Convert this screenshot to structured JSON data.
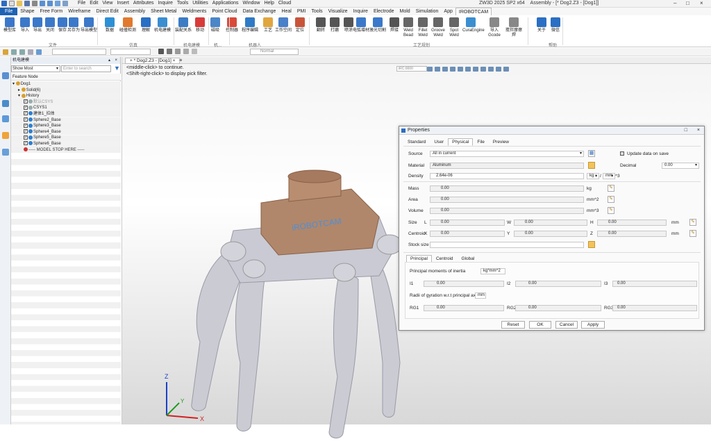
{
  "titlebar": {
    "menus": [
      "File",
      "Edit",
      "View",
      "Insert",
      "Attributes",
      "Inquire",
      "Tools",
      "Utilities",
      "Applications",
      "Window",
      "Help",
      "Cloud"
    ],
    "window_title": "ZW3D 2025 SP2 x64",
    "doc_title": "Assembly - [* Dog2.Z3 - [Dog1]]"
  },
  "ribbon_tabs": [
    "File",
    "Shape",
    "Free Form",
    "Wireframe",
    "Direct Edit",
    "Assembly",
    "Sheet Metal",
    "Weldments",
    "Point Cloud",
    "Data Exchange",
    "Heal",
    "PMI",
    "Tools",
    "Visualize",
    "Inquire",
    "Electrode",
    "Mold",
    "Simulation",
    "App",
    "IROBOTCAM"
  ],
  "ribbon_buttons": [
    "模型库",
    "导入",
    "导出",
    "关闭",
    "保存",
    "另存为",
    "导出模型",
    "数据",
    "碰撞检测",
    "理解",
    "机电建模",
    "装配关系",
    "移动",
    "磁吸",
    "控制器",
    "程序编辑",
    "工艺",
    "工作空间",
    "定位",
    "翻转",
    "打磨",
    "喷涂",
    "电弧增材",
    "激光切割",
    "焊接",
    "Weld Bead",
    "Fillet Weld",
    "Groove Weld",
    "Spot Weld",
    "CuraEngine",
    "导入Gcode",
    "搅拌摩擦焊",
    "关于",
    "微信"
  ],
  "ribbon_groups": [
    "文件",
    "仿真",
    "机电建模",
    "机...",
    "机器人",
    "工艺规划",
    "帮助"
  ],
  "left_panel": {
    "title": "机电建模",
    "filter_value": "Show Most",
    "search_placeholder": "Enter to search",
    "header": "Feature Node",
    "tree": [
      {
        "label": "Dog1",
        "indent": 0,
        "kind": "root"
      },
      {
        "label": "Solid(6)",
        "indent": 1,
        "kind": "folder"
      },
      {
        "label": "History",
        "indent": 1,
        "kind": "folder"
      },
      {
        "label": "默认CSYS",
        "indent": 2,
        "kind": "csys"
      },
      {
        "label": "CSYS1",
        "indent": 2,
        "kind": "csys"
      },
      {
        "label": "建体1_拉体",
        "indent": 2,
        "kind": "feature"
      },
      {
        "label": "Sphere2_Base",
        "indent": 2,
        "kind": "feature"
      },
      {
        "label": "Sphere3_Base",
        "indent": 2,
        "kind": "feature"
      },
      {
        "label": "Sphere4_Base",
        "indent": 2,
        "kind": "feature"
      },
      {
        "label": "Sphere5_Base",
        "indent": 2,
        "kind": "feature"
      },
      {
        "label": "Sphere6_Base",
        "indent": 2,
        "kind": "feature"
      },
      {
        "label": "----- MODEL STOP HERE -----",
        "indent": 2,
        "kind": "stop"
      }
    ]
  },
  "viewport": {
    "doc_tab": "* Dog2.Z3 - [Dog1]",
    "hint_lines": [
      "<middle-click> to continue.",
      "<Shift-right-click> to display pick filter."
    ],
    "render_mode": "Normal",
    "view_field": "iRC:0000"
  },
  "axes": {
    "x": "X",
    "y": "Y",
    "z": "Z"
  },
  "model": {
    "logo_text": "iROBOTCAM"
  },
  "properties": {
    "title": "Properties",
    "tabs": [
      "Standard",
      "User",
      "Physical",
      "File",
      "Preview"
    ],
    "active_tab": "Physical",
    "source_label": "Source",
    "source_value": "All in current",
    "update_label": "Update data on save",
    "material_label": "Material",
    "material_value": "Aluminum",
    "decimal_label": "Decimal",
    "decimal_value": "0.00",
    "density_label": "Density",
    "density_value": "2.64e-06",
    "density_unit1": "kg",
    "density_unit2": "mm",
    "density_unit3": "^3",
    "mass_label": "Mass",
    "mass_value": "0.00",
    "mass_unit": "kg",
    "area_label": "Area",
    "area_value": "0.00",
    "area_unit": "mm^2",
    "volume_label": "Volume",
    "volume_value": "0.00",
    "volume_unit": "mm^3",
    "size_label": "Size",
    "size": {
      "L": "0.00",
      "W": "0.00",
      "H": "0.00"
    },
    "centroid_label": "Centroid",
    "centroid": {
      "X": "0.00",
      "Y": "0.00",
      "Z": "0.00"
    },
    "len_unit": "mm",
    "stock_label": "Stock size",
    "subtabs": [
      "Principal",
      "Centroid",
      "Global"
    ],
    "inertia_label": "Principal moments of inertia",
    "inertia_unit": "kg*mm^2",
    "I": {
      "I1": "0.00",
      "I2": "0.00",
      "I3": "0.00"
    },
    "gyration_label": "Radii of gyration w.r.t principal axes",
    "gyration_unit": "mm",
    "RG": {
      "RG1": "0.00",
      "RG2": "0.00",
      "RG3": "0.00"
    },
    "buttons": [
      "Reset",
      "OK",
      "Cancel",
      "Apply"
    ]
  },
  "colors": {
    "accent": "#1f63b4",
    "model_body": "#b0876b",
    "model_grey": "#c9cad3"
  }
}
